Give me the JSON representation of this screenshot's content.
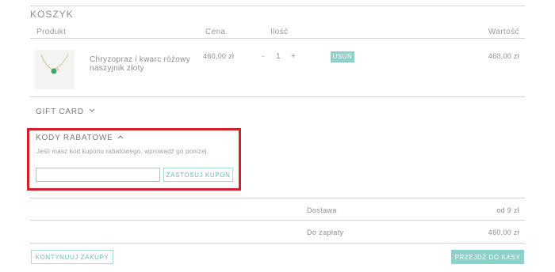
{
  "cart": {
    "title": "KOSZYK",
    "columns": {
      "product": "Produkt",
      "price": "Cena",
      "quantity": "Ilość",
      "value": "Wartość"
    },
    "items": [
      {
        "name": "Chryzopraz i kwarc różowy naszyjnik złoty",
        "price": "460,00 zł",
        "qty_minus": "-",
        "qty": "1",
        "qty_plus": "+",
        "remove_label": "USUŃ",
        "value": "460,00 zł"
      }
    ]
  },
  "gift_card": {
    "label": "GIFT CARD",
    "icon": "chevron-down-icon"
  },
  "discount": {
    "label": "KODY RABATOWE",
    "icon": "chevron-up-icon",
    "hint": "Jeśli masz kod kuponu rabatowego, wprowadź go poniżej.",
    "input_value": "",
    "input_placeholder": "",
    "apply_label": "ZASTOSUJ KUPON"
  },
  "summary": {
    "shipping_label": "Dostawa",
    "shipping_value": "od 9 zł",
    "total_label": "Do zapłaty",
    "total_value": "460,00 zł"
  },
  "actions": {
    "continue_label": "KONTYNUUJ ZAKUPY",
    "checkout_label": "PRZEJDŹ DO KASY"
  },
  "colors": {
    "accent": "#8fd0ca",
    "highlight": "#d0202b",
    "text": "#8a8a8a"
  }
}
